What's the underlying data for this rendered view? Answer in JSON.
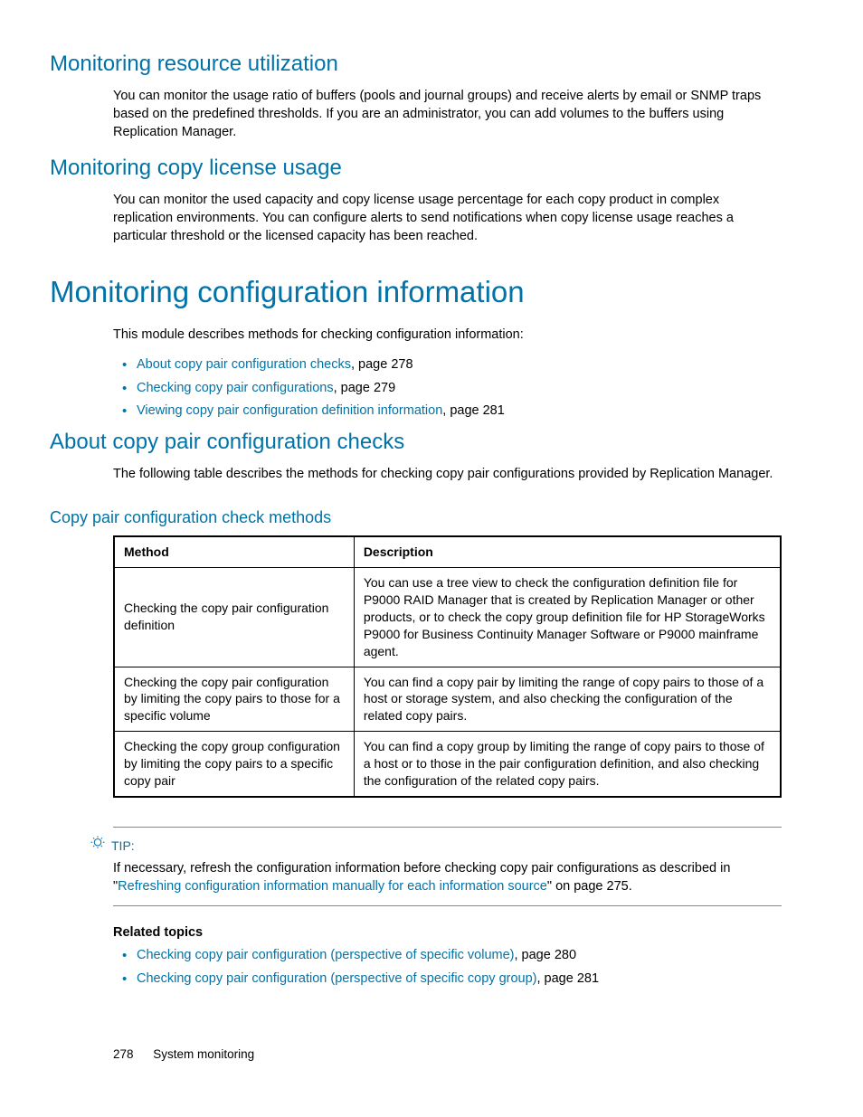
{
  "sec1": {
    "heading": "Monitoring resource utilization",
    "body": "You can monitor the usage ratio of buffers (pools and journal groups) and receive alerts by email or SNMP traps based on the predefined thresholds. If you are an administrator, you can add volumes to the buffers using Replication Manager."
  },
  "sec2": {
    "heading": "Monitoring copy license usage",
    "body": "You can monitor the used capacity and copy license usage percentage for each copy product in complex replication environments. You can configure alerts to send notifications when copy license usage reaches a particular threshold or the licensed capacity has been reached."
  },
  "sec3": {
    "heading": "Monitoring configuration information",
    "intro": "This module describes methods for checking configuration information:",
    "links": [
      {
        "text": "About copy pair configuration checks",
        "suffix": ", page 278"
      },
      {
        "text": "Checking copy pair configurations",
        "suffix": ", page 279"
      },
      {
        "text": "Viewing copy pair configuration definition information",
        "suffix": ", page 281"
      }
    ]
  },
  "sec4": {
    "heading": "About copy pair configuration checks",
    "body": "The following table describes the methods for checking copy pair configurations provided by Replication Manager."
  },
  "table": {
    "caption": "Copy pair configuration check methods",
    "headers": {
      "method": "Method",
      "description": "Description"
    },
    "rows": [
      {
        "method": "Checking the copy pair configuration definition",
        "description": "You can use a tree view to check the configuration definition file for P9000 RAID Manager that is created by Replication Manager or other products, or to check the copy group definition file for HP StorageWorks P9000 for Business Continuity Manager Software or P9000 mainframe agent."
      },
      {
        "method": "Checking the copy pair configuration by limiting the copy pairs to those for a specific volume",
        "description": "You can find a copy pair by limiting the range of copy pairs to those of a host or storage system, and also checking the configuration of the related copy pairs."
      },
      {
        "method": "Checking the copy group configuration by limiting the copy pairs to a specific copy pair",
        "description": "You can find a copy group by limiting the range of copy pairs to those of a host or to those in the pair configuration definition, and also checking the configuration of the related copy pairs."
      }
    ]
  },
  "tip": {
    "label": "TIP:",
    "prefix": "If necessary, refresh the configuration information before checking copy pair configurations as described in \"",
    "link": "Refreshing configuration information manually for each information source",
    "suffix": "\" on page 275."
  },
  "related": {
    "heading": "Related topics",
    "items": [
      {
        "text": "Checking copy pair configuration (perspective of specific volume)",
        "suffix": ", page 280"
      },
      {
        "text": "Checking copy pair configuration (perspective of specific copy group)",
        "suffix": ", page 281"
      }
    ]
  },
  "footer": {
    "page": "278",
    "title": "System monitoring"
  }
}
